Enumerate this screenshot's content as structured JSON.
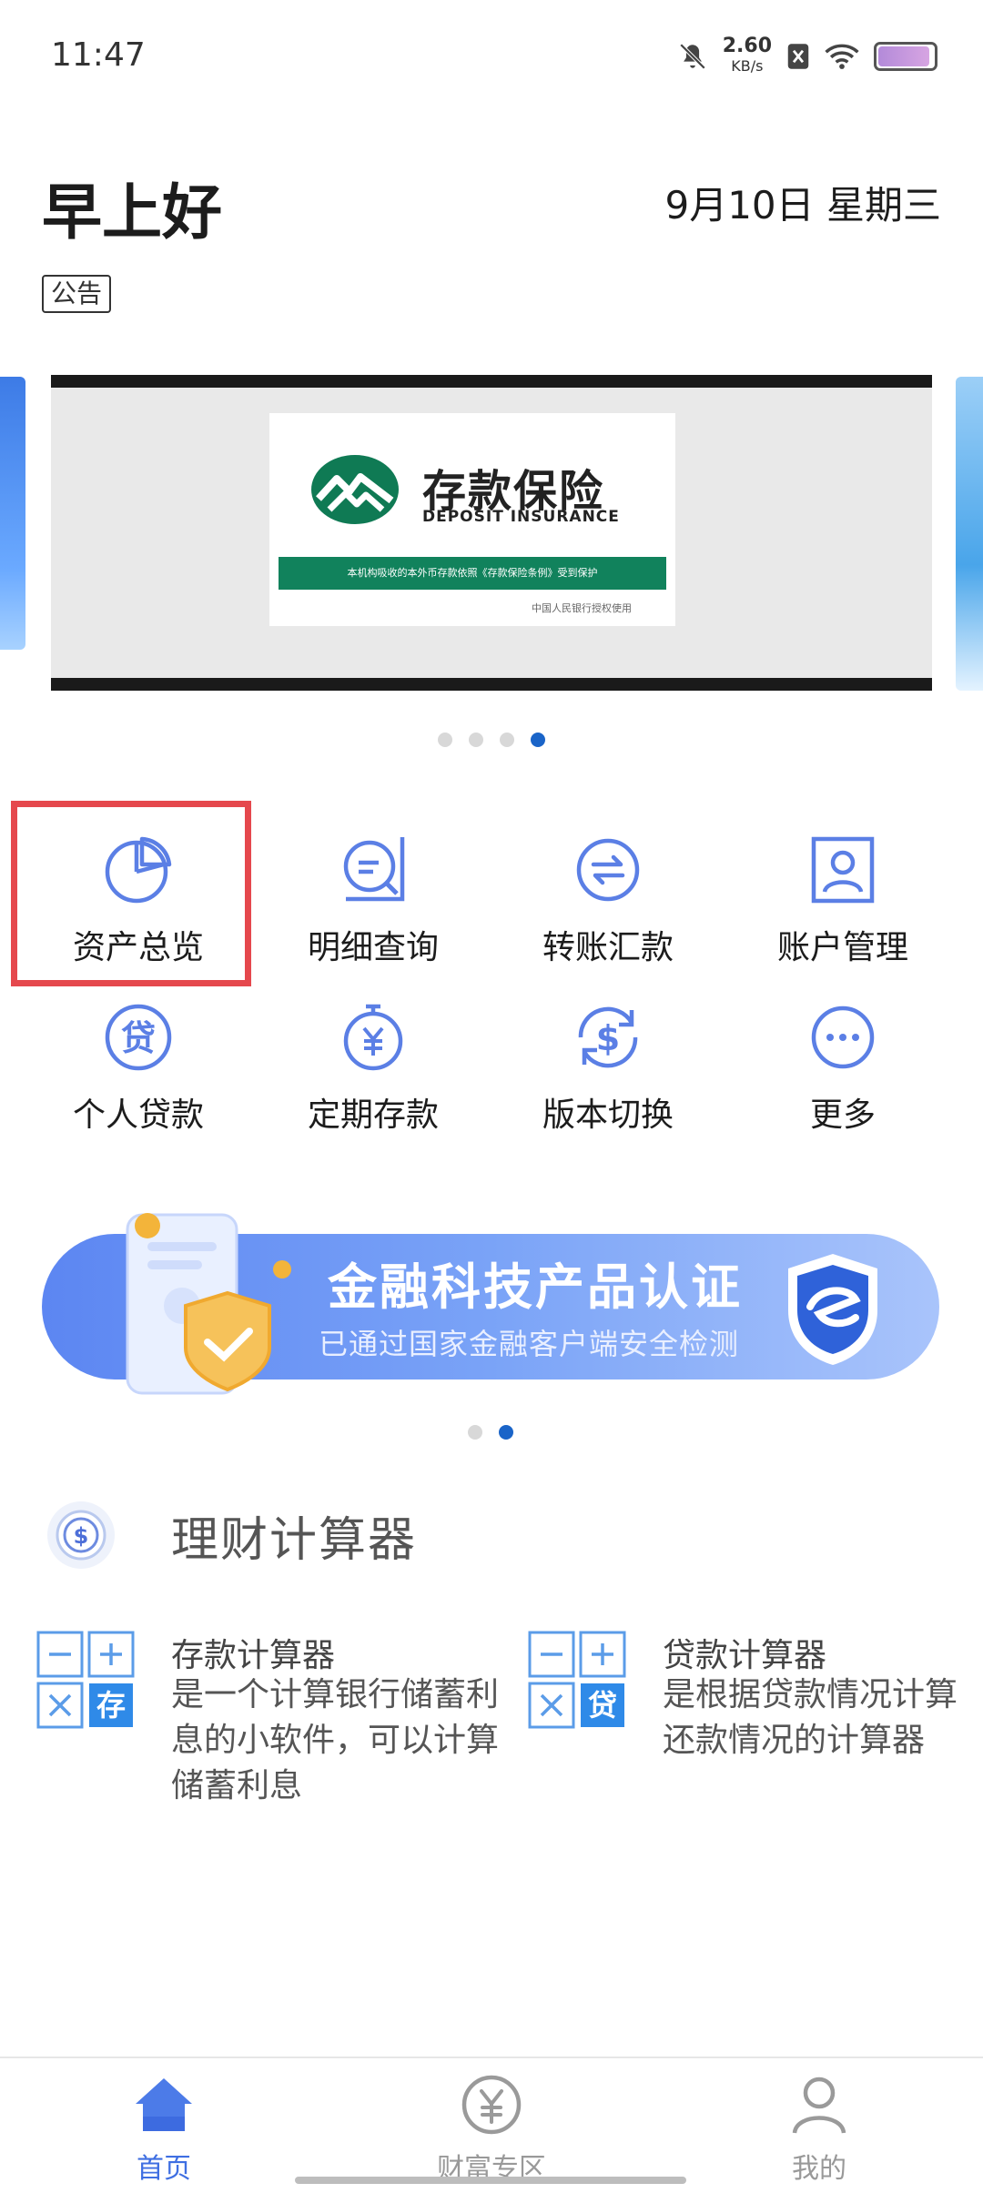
{
  "status_bar": {
    "time": "11:47",
    "net_speed_value": "2.60",
    "net_speed_unit": "KB/s"
  },
  "header": {
    "greeting": "早上好",
    "date": "9月10日 星期三",
    "notice_tag": "公告"
  },
  "carousel": {
    "insurance_title": "存款保险",
    "insurance_subtitle": "DEPOSIT INSURANCE",
    "insurance_strip": "本机构吸收的本外币存款依照《存款保险条例》受到保护",
    "insurance_footer": "中国人民银行授权使用",
    "page_count": 4,
    "active_page": 4
  },
  "quick_actions": [
    {
      "label": "资产总览",
      "icon": "pie-chart-icon"
    },
    {
      "label": "明细查询",
      "icon": "search-document-icon"
    },
    {
      "label": "转账汇款",
      "icon": "transfer-arrows-icon"
    },
    {
      "label": "账户管理",
      "icon": "user-card-icon"
    },
    {
      "label": "个人贷款",
      "icon": "loan-icon"
    },
    {
      "label": "定期存款",
      "icon": "timer-yuan-icon"
    },
    {
      "label": "版本切换",
      "icon": "dollar-refresh-icon"
    },
    {
      "label": "更多",
      "icon": "more-dots-icon"
    }
  ],
  "promo_banner": {
    "title": "金融科技产品认证",
    "subtitle": "已通过国家金融客户端安全检测",
    "page_count": 2,
    "active_page": 2
  },
  "calculator": {
    "section_title": "理财计算器",
    "items": [
      {
        "name": "存款计算器",
        "badge": "存",
        "desc": "是一个计算银行储蓄利息的小软件，可以计算储蓄利息"
      },
      {
        "name": "贷款计算器",
        "badge": "贷",
        "desc": "是根据贷款情况计算还款情况的计算器"
      }
    ]
  },
  "bottom_nav": [
    {
      "label": "首页",
      "icon": "home-icon",
      "active": true
    },
    {
      "label": "财富专区",
      "icon": "yuan-circle-icon",
      "active": false
    },
    {
      "label": "我的",
      "icon": "person-icon",
      "active": false
    }
  ],
  "colors": {
    "accent": "#5b7fe5",
    "active_nav": "#3f6fe2",
    "highlight": "#e5484d",
    "insurance_green": "#11825c"
  }
}
